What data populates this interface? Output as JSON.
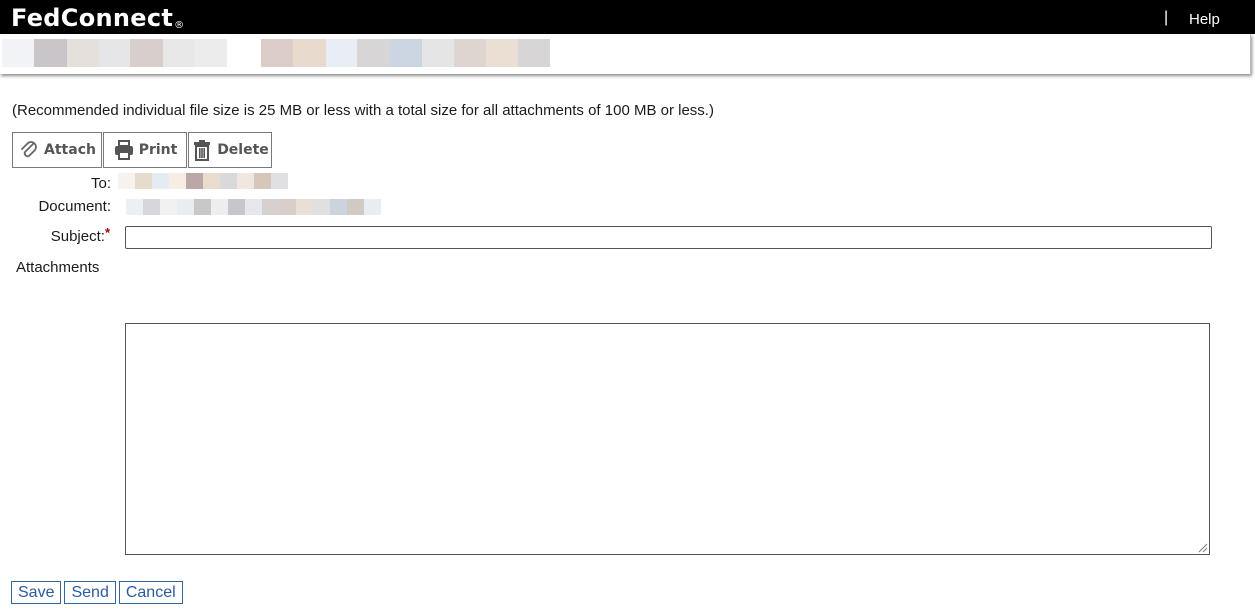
{
  "header": {
    "logo_text": "FedConnect",
    "logo_mark": "®",
    "separator": "|",
    "help_label": "Help"
  },
  "notice": "(Recommended individual file size is 25 MB or less with a total size for all attachments of 100 MB or less.)",
  "toolbar": {
    "attach_label": "Attach",
    "print_label": "Print",
    "delete_label": "Delete"
  },
  "form": {
    "to_label": "To:",
    "document_label": "Document:",
    "subject_label": "Subject:",
    "required_marker": "*",
    "subject_value": "",
    "attachments_label": "Attachments",
    "body_value": ""
  },
  "actions": {
    "save_label": "Save",
    "send_label": "Send",
    "cancel_label": "Cancel"
  },
  "colors": {
    "topbar": "#000000",
    "link_button": "#2b5c9c",
    "required": "#aa0000"
  }
}
